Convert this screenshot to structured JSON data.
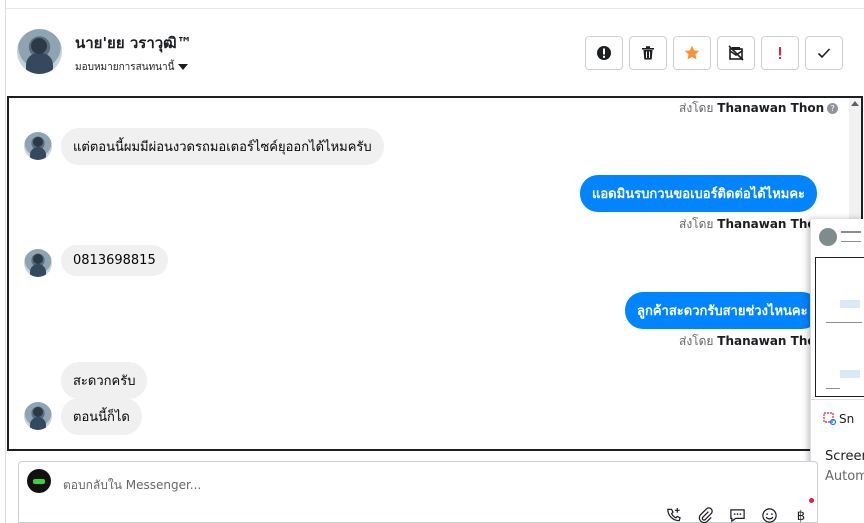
{
  "header": {
    "name": "นาย'ยย วราวุฒิ™",
    "assign_label": "มอบหมายการสนทนานี้",
    "toolbar": [
      {
        "name": "info-button",
        "icon": "exclamation-circle-icon"
      },
      {
        "name": "trash-button",
        "icon": "trash-icon"
      },
      {
        "name": "star-button",
        "icon": "star-icon"
      },
      {
        "name": "mark-spam-button",
        "icon": "envelope-slash-icon"
      },
      {
        "name": "priority-button",
        "icon": "red-exclamation-icon"
      },
      {
        "name": "done-button",
        "icon": "check-icon"
      }
    ]
  },
  "messages": {
    "sender_prefix": "ส่งโดย",
    "sender_name": "Thanawan Thon",
    "m1": "แต่ตอนนี้ผมมีผ่อนงวดรถมอเตอร์ไซค์ยุออกได้ไหมครับ",
    "m2": "แอดมินรบกวนขอเบอร์ติดต่อได้ไหมคะ",
    "m3": "0813698815",
    "m4": "ลูกค้าสะดวกรับสายช่วงไหนคะ",
    "m5": "สะดวกครับ",
    "m6": "ตอนนี้ก็ได"
  },
  "overlay": {
    "app_label": "Sn",
    "title": "Screen",
    "subtitle": "Autom"
  },
  "composer": {
    "placeholder": "ตอบกลับใน Messenger..."
  },
  "colors": {
    "accent": "#0084ff",
    "star": "#f7923b",
    "priority": "#e41e3f"
  }
}
